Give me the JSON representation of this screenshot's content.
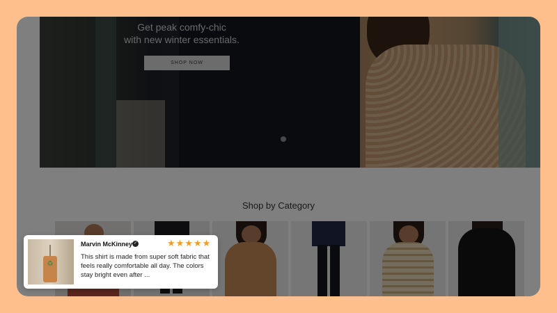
{
  "hero": {
    "subtitle_line1": "Get peak comfy-chic",
    "subtitle_line2": "with new winter essentials.",
    "cta_label": "SHOP NOW"
  },
  "categories": {
    "title": "Shop by Category"
  },
  "review": {
    "reviewer": "Marvin McKinney",
    "rating": 5,
    "stars": [
      "★",
      "★",
      "★",
      "★",
      "★"
    ],
    "text": "This shirt is made from super soft fabric that feels really comfortable all day. The colors stay bright even after ...",
    "tag_icon": "♻",
    "verified_icon": "✓"
  },
  "colors": {
    "page_background": "#ffbf8c",
    "star": "#f59b23",
    "overlay": "rgba(0,0,0,0.5)"
  }
}
